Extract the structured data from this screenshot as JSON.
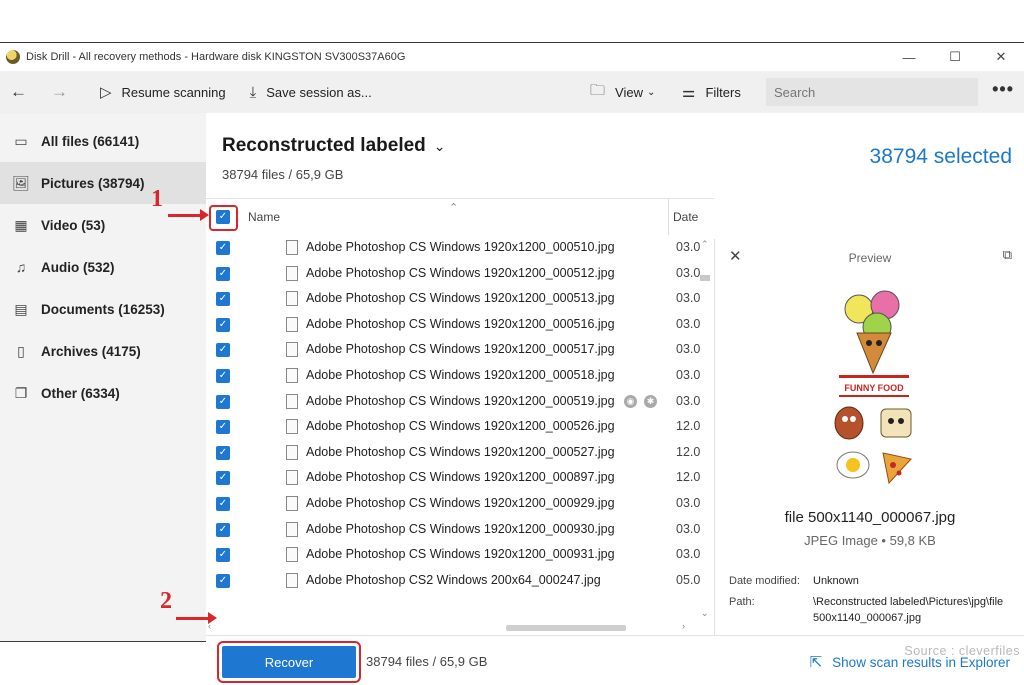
{
  "window": {
    "title": "Disk Drill - All recovery methods - Hardware disk KINGSTON SV300S37A60G",
    "controls": [
      "—",
      "☐",
      "✕"
    ]
  },
  "toolbar": {
    "back_icon": "arrow-left-icon",
    "forward_icon": "arrow-right-icon",
    "resume_label": "Resume scanning",
    "save_label": "Save session as...",
    "view_label": "View",
    "filters_label": "Filters",
    "search_placeholder": "Search",
    "more_label": "•••"
  },
  "sidebar": {
    "items": [
      {
        "label": "All files (66141)",
        "icon": "▭"
      },
      {
        "label": "Pictures (38794)",
        "icon": "🖼"
      },
      {
        "label": "Video (53)",
        "icon": "▦"
      },
      {
        "label": "Audio (532)",
        "icon": "♫"
      },
      {
        "label": "Documents (16253)",
        "icon": "▤"
      },
      {
        "label": "Archives (4175)",
        "icon": "▯"
      },
      {
        "label": "Other (6334)",
        "icon": "❐"
      }
    ]
  },
  "header": {
    "title": "Reconstructed labeled",
    "subtitle": "38794 files / 65,9 GB",
    "selected": "38794 selected"
  },
  "list": {
    "col_name": "Name",
    "col_date": "Date",
    "rows": [
      {
        "name": "Adobe Photoshop CS Windows 1920x1200_000510.jpg",
        "date": "03.0"
      },
      {
        "name": "Adobe Photoshop CS Windows 1920x1200_000512.jpg",
        "date": "03.0"
      },
      {
        "name": "Adobe Photoshop CS Windows 1920x1200_000513.jpg",
        "date": "03.0"
      },
      {
        "name": "Adobe Photoshop CS Windows 1920x1200_000516.jpg",
        "date": "03.0"
      },
      {
        "name": "Adobe Photoshop CS Windows 1920x1200_000517.jpg",
        "date": "03.0"
      },
      {
        "name": "Adobe Photoshop CS Windows 1920x1200_000518.jpg",
        "date": "03.0"
      },
      {
        "name": "Adobe Photoshop CS Windows 1920x1200_000519.jpg",
        "date": "03.0"
      },
      {
        "name": "Adobe Photoshop CS Windows 1920x1200_000526.jpg",
        "date": "12.0"
      },
      {
        "name": "Adobe Photoshop CS Windows 1920x1200_000527.jpg",
        "date": "12.0"
      },
      {
        "name": "Adobe Photoshop CS Windows 1920x1200_000897.jpg",
        "date": "12.0"
      },
      {
        "name": "Adobe Photoshop CS Windows 1920x1200_000929.jpg",
        "date": "03.0"
      },
      {
        "name": "Adobe Photoshop CS Windows 1920x1200_000930.jpg",
        "date": "03.0"
      },
      {
        "name": "Adobe Photoshop CS Windows 1920x1200_000931.jpg",
        "date": "03.0"
      },
      {
        "name": "Adobe Photoshop CS2 Windows 200x64_000247.jpg",
        "date": "05.0"
      }
    ]
  },
  "preview": {
    "title": "Preview",
    "image_caption": "FUNNY FOOD",
    "file_name": "file 500x1140_000067.jpg",
    "file_type": "JPEG Image • 59,8 KB",
    "date_modified_label": "Date modified:",
    "date_modified_value": "Unknown",
    "path_label": "Path:",
    "path_value": "\\Reconstructed labeled\\Pictures\\jpg\\file 500x1140_000067.jpg"
  },
  "footer": {
    "recover_label": "Recover",
    "info": "38794 files / 65,9 GB",
    "explorer_label": "Show scan results in Explorer"
  },
  "annotations": {
    "marker_1": "1",
    "marker_2": "2",
    "source": "Source : cleverfiles"
  },
  "colors": {
    "accent": "#1e78d2",
    "highlight": "#d9262c"
  }
}
